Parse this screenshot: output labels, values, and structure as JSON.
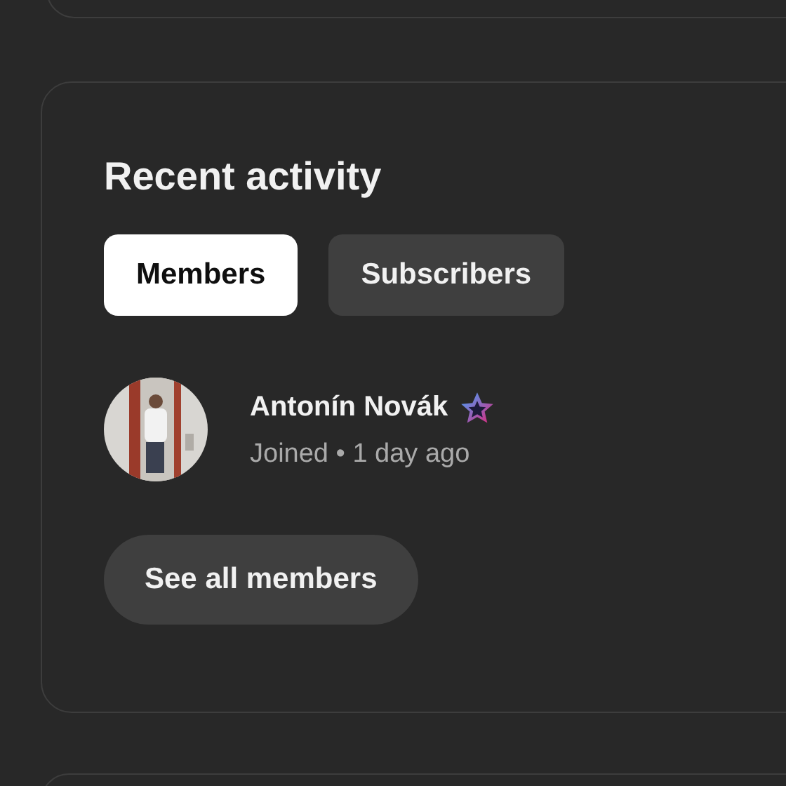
{
  "recent_activity": {
    "title": "Recent activity",
    "tabs": [
      {
        "label": "Members",
        "selected": true
      },
      {
        "label": "Subscribers",
        "selected": false
      }
    ],
    "items": [
      {
        "name": "Antonín Novák",
        "badge": true,
        "status": "Joined • 1 day ago"
      }
    ],
    "button": "See all members"
  }
}
